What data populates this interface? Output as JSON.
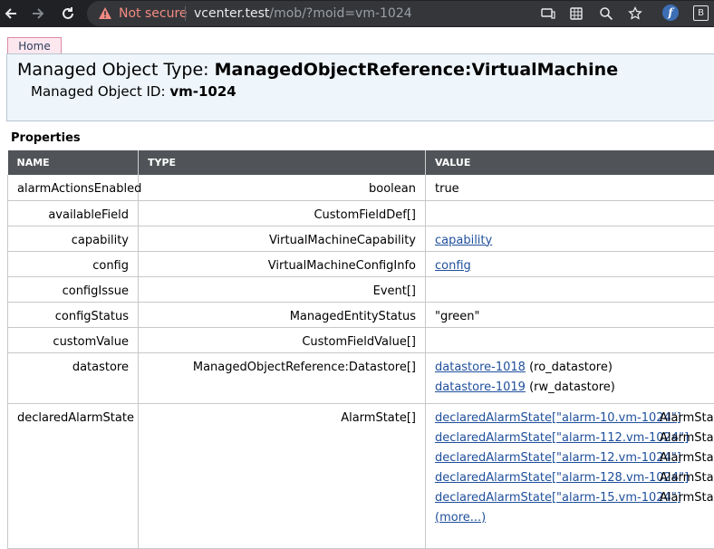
{
  "browser": {
    "not_secure": "Not secure",
    "url_host": "vcenter.test",
    "url_rest": "/mob/?moid=vm-1024"
  },
  "home_tab": "Home",
  "header": {
    "type_label": "Managed Object Type:",
    "type_value": "ManagedObjectReference:VirtualMachine",
    "id_label": "Managed Object ID:",
    "id_value": "vm-1024"
  },
  "properties": {
    "title": "Properties",
    "columns": [
      "NAME",
      "TYPE",
      "VALUE"
    ],
    "rows": [
      {
        "name": "alarmActionsEnabled",
        "type": "boolean",
        "value": "true"
      },
      {
        "name": "availableField",
        "type": "CustomFieldDef[]",
        "value": ""
      },
      {
        "name": "capability",
        "type": "VirtualMachineCapability",
        "link": "capability"
      },
      {
        "name": "config",
        "type": "VirtualMachineConfigInfo",
        "link": "config"
      },
      {
        "name": "configIssue",
        "type": "Event[]",
        "value": ""
      },
      {
        "name": "configStatus",
        "type": "ManagedEntityStatus",
        "value": "\"green\""
      },
      {
        "name": "customValue",
        "type": "CustomFieldValue[]",
        "value": ""
      },
      {
        "name": "datastore",
        "type": "ManagedObjectReference:Datastore[]",
        "links": [
          {
            "link": "datastore-1018",
            "after": "(ro_datastore)"
          },
          {
            "link": "datastore-1019",
            "after": "(rw_datastore)"
          }
        ]
      },
      {
        "name": "declaredAlarmState",
        "type": "AlarmState[]",
        "links": [
          {
            "link": "declaredAlarmState[\"alarm-10.vm-1024\"]",
            "after": "AlarmState"
          },
          {
            "link": "declaredAlarmState[\"alarm-112.vm-1024\"]",
            "after": "AlarmState"
          },
          {
            "link": "declaredAlarmState[\"alarm-12.vm-1024\"]",
            "after": "AlarmState"
          },
          {
            "link": "declaredAlarmState[\"alarm-128.vm-1024\"]",
            "after": "AlarmState"
          },
          {
            "link": "declaredAlarmState[\"alarm-15.vm-1024\"]",
            "after": "AlarmState"
          }
        ],
        "more": "(more...)"
      }
    ]
  }
}
